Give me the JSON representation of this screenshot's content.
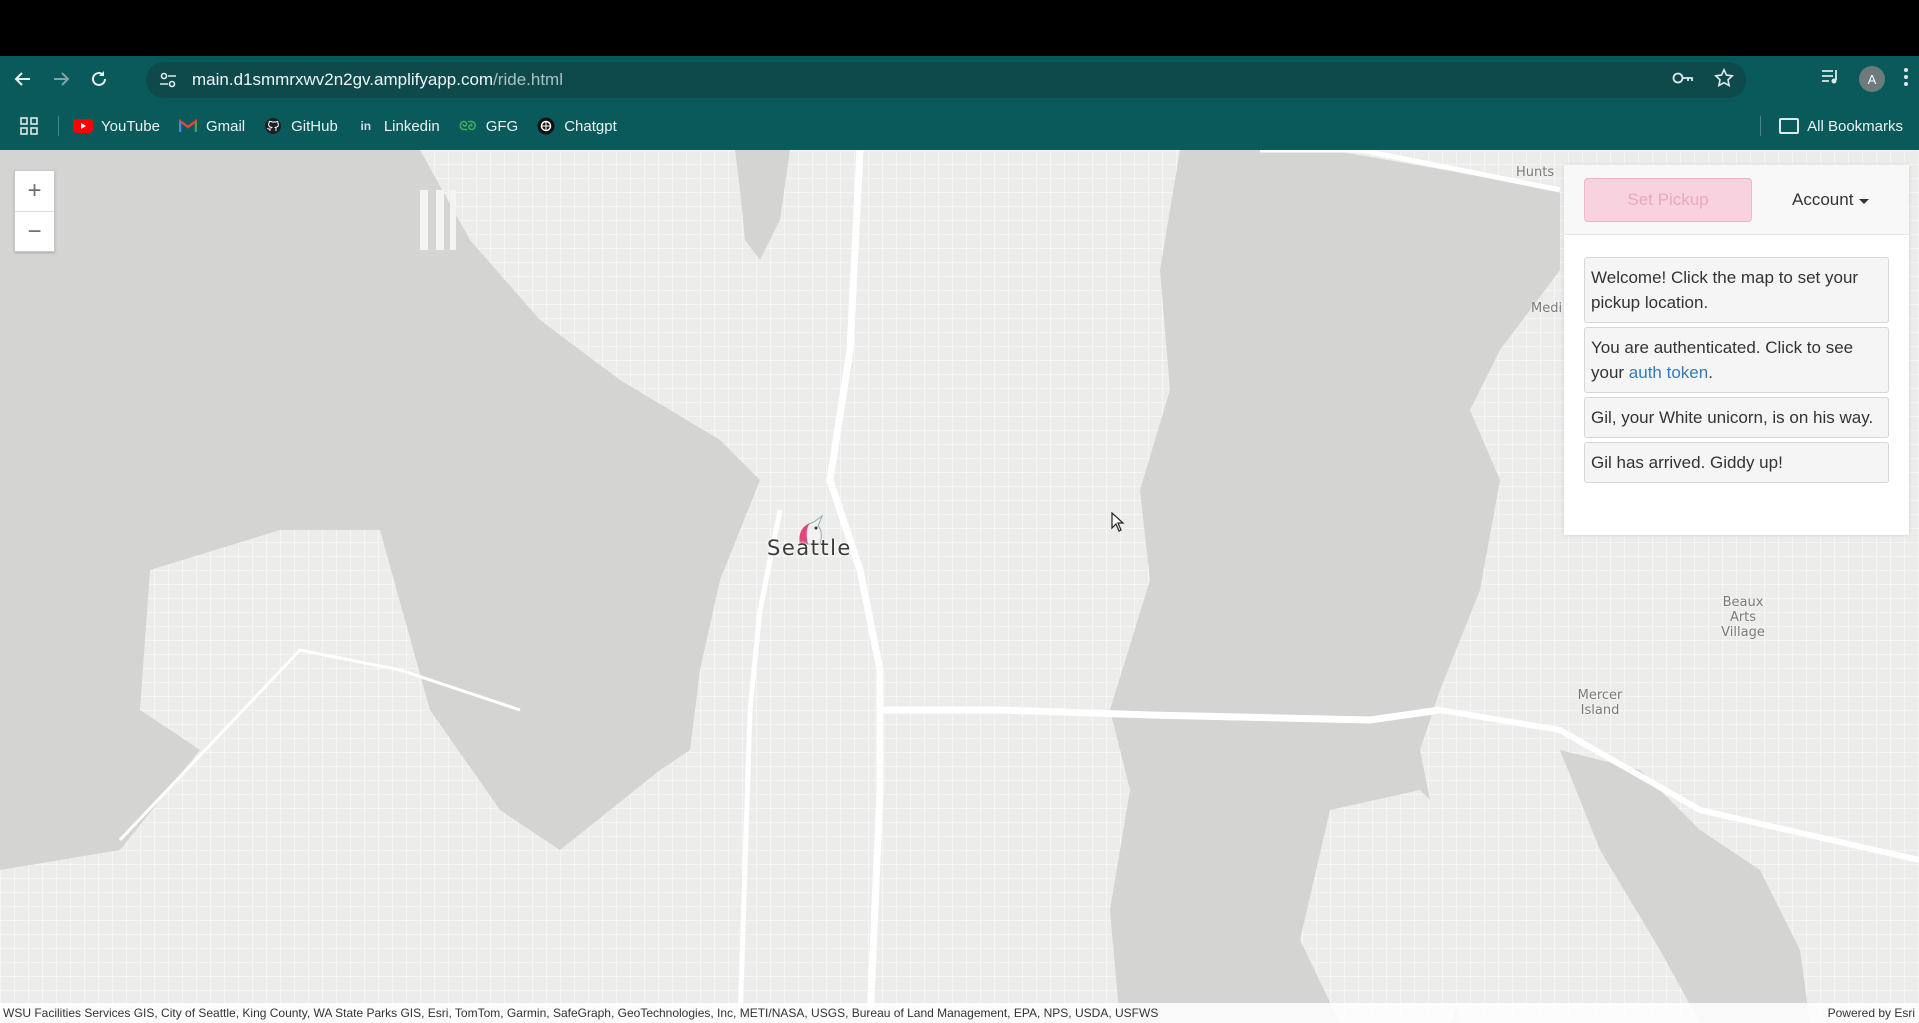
{
  "browser": {
    "url_host": "main.d1smmrxwv2n2gv.amplifyapp.com",
    "url_path": "/ride.html",
    "profile_initial": "A"
  },
  "bookmarks": {
    "items": [
      {
        "label": "YouTube",
        "icon": "youtube-icon",
        "color": "#ff0000"
      },
      {
        "label": "Gmail",
        "icon": "gmail-icon",
        "color": "#ea4335"
      },
      {
        "label": "GitHub",
        "icon": "github-icon",
        "color": "#ffffff"
      },
      {
        "label": "Linkedin",
        "icon": "linkedin-icon",
        "color": "#0a66c2"
      },
      {
        "label": "GFG",
        "icon": "gfg-icon",
        "color": "#2f8d46"
      },
      {
        "label": "Chatgpt",
        "icon": "chatgpt-icon",
        "color": "#ffffff"
      }
    ],
    "all_bookmarks": "All Bookmarks"
  },
  "map": {
    "zoom_in": "+",
    "zoom_out": "−",
    "city_label": "Seattle",
    "places": {
      "hunts": "Hunts",
      "medi": "Medi",
      "beaux_arts": "Beaux Arts\nVillage",
      "mercer": "Mercer\nIsland"
    },
    "attribution": "WSU Facilities Services GIS, City of Seattle, King County, WA State Parks GIS, Esri, TomTom, Garmin, SafeGraph, GeoTechnologies, Inc, METI/NASA, USGS, Bureau of Land Management, EPA, NPS, USDA, USFWS",
    "powered_by": "Powered by Esri"
  },
  "panel": {
    "set_pickup": "Set Pickup",
    "account": "Account",
    "msg_welcome": "Welcome! Click the map to set your pickup location.",
    "msg_auth_prefix": "You are authenticated. Click to see your ",
    "msg_auth_link": "auth token",
    "msg_auth_suffix": ".",
    "msg_onway": "Gil, your White unicorn, is on his way.",
    "msg_arrived": "Gil has arrived. Giddy up!"
  },
  "colors": {
    "chrome": "#0a5a5c",
    "accent_pink": "#f8d3df",
    "link": "#337ab7"
  }
}
